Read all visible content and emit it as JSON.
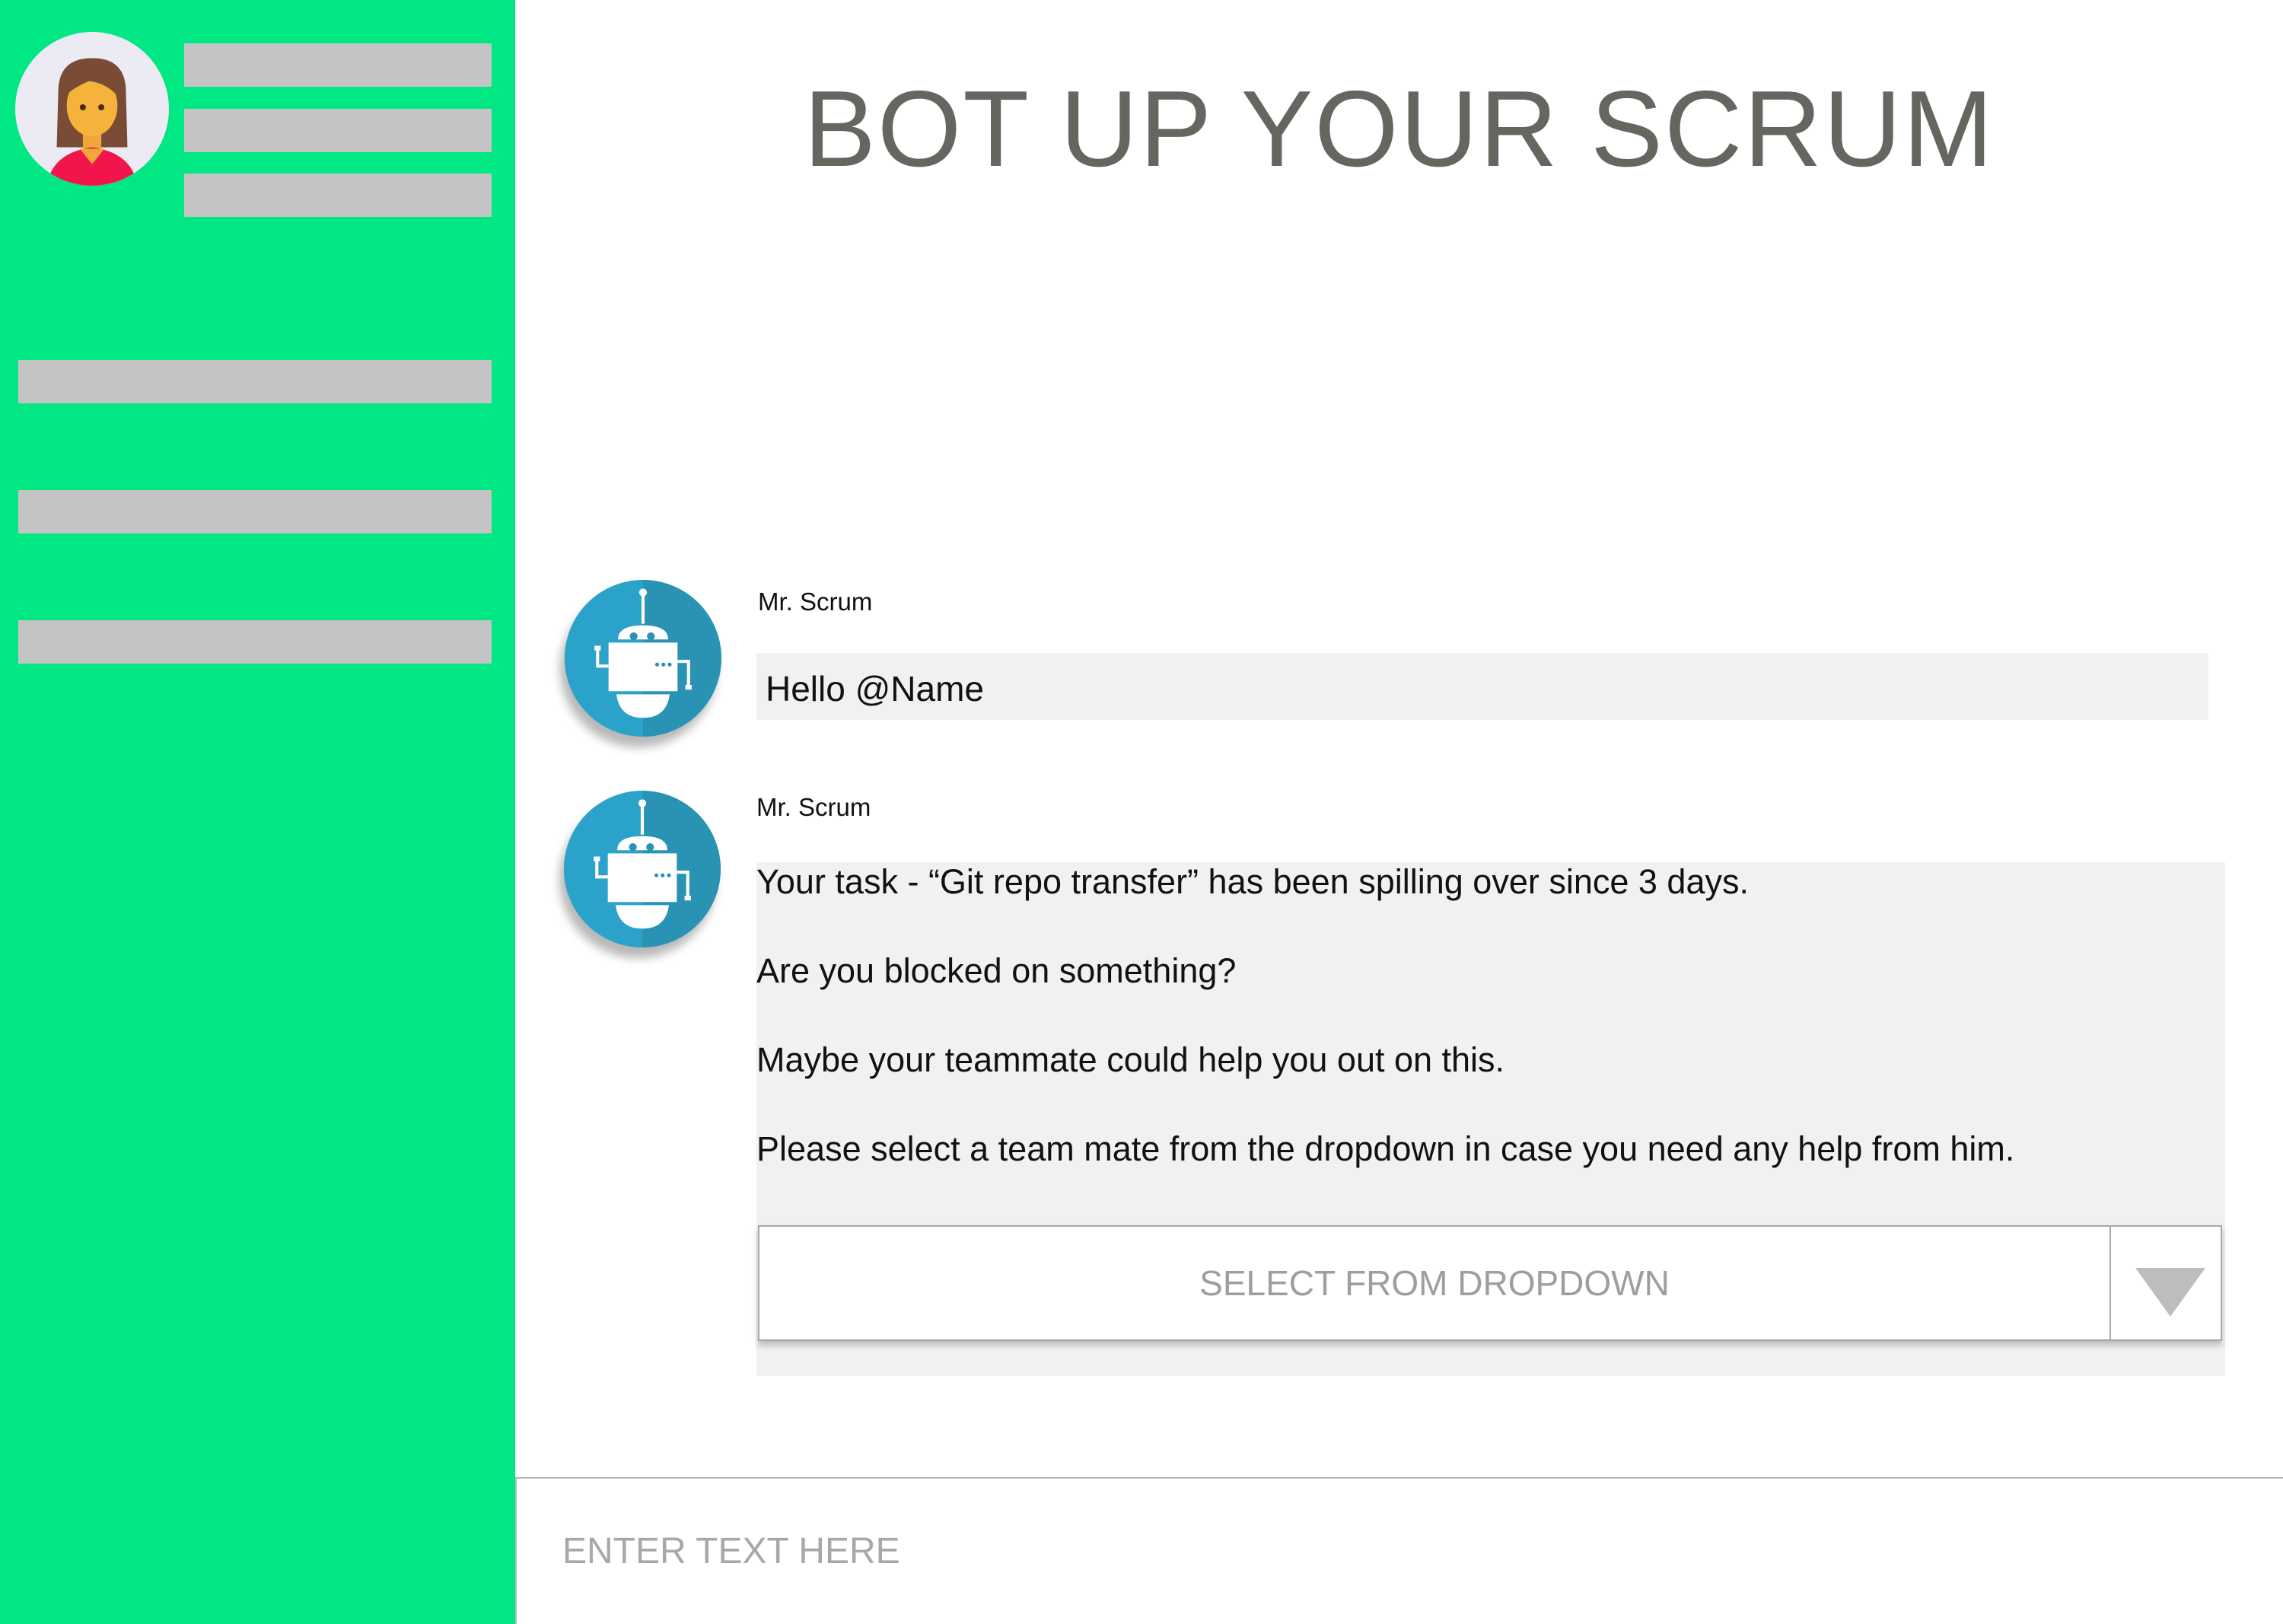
{
  "header": {
    "title": "BOT UP YOUR SCRUM"
  },
  "sidebar": {
    "avatar_icon": "woman-avatar-icon",
    "accent_color": "#00e784"
  },
  "messages": [
    {
      "sender": "Mr. Scrum",
      "avatar_icon": "robot-icon",
      "lines": [
        "Hello @Name"
      ]
    },
    {
      "sender": "Mr. Scrum",
      "avatar_icon": "robot-icon",
      "lines": [
        "Your task - “Git repo transfer” has been spilling over since 3 days.",
        "Are you blocked on something?",
        "Maybe your teammate could help you out on this.",
        "Please select a team mate from the dropdown in case you need any help from him."
      ],
      "dropdown": {
        "selected": "SELECT FROM DROPDOWN"
      }
    }
  ],
  "composer": {
    "placeholder": "ENTER TEXT HERE"
  }
}
